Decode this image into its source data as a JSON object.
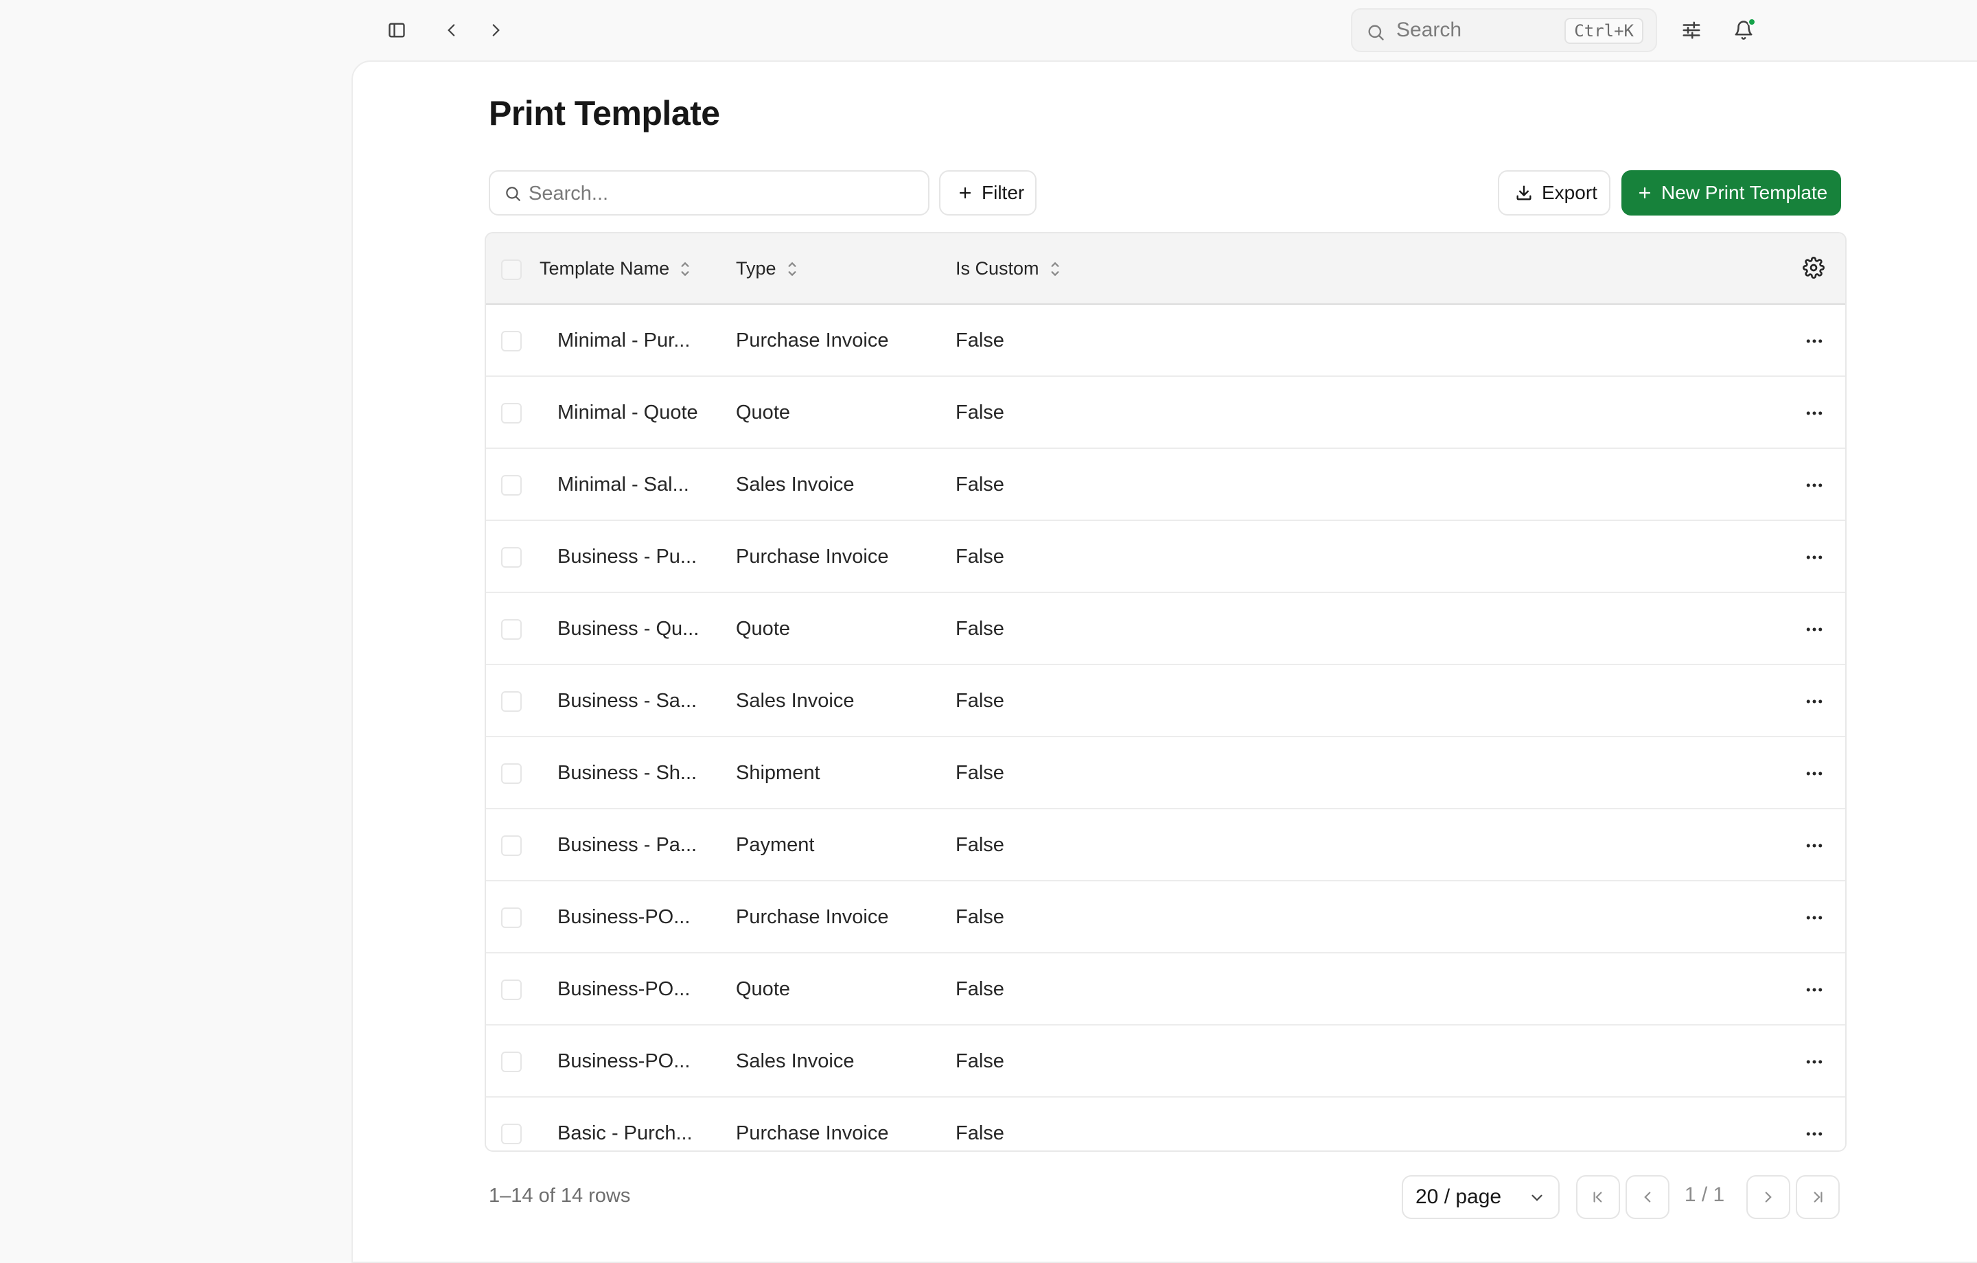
{
  "topbar": {
    "search_placeholder": "Search",
    "search_shortcut": "Ctrl+K"
  },
  "page": {
    "title": "Print Template"
  },
  "toolbar": {
    "search_placeholder": "Search...",
    "filter_label": "Filter",
    "export_label": "Export",
    "new_label": "New Print Template"
  },
  "table": {
    "columns": [
      "Template Name",
      "Type",
      "Is Custom"
    ],
    "rows": [
      {
        "name": "Minimal - Pur...",
        "type": "Purchase Invoice",
        "custom": "False"
      },
      {
        "name": "Minimal - Quote",
        "type": "Quote",
        "custom": "False"
      },
      {
        "name": "Minimal - Sal...",
        "type": "Sales Invoice",
        "custom": "False"
      },
      {
        "name": "Business - Pu...",
        "type": "Purchase Invoice",
        "custom": "False"
      },
      {
        "name": "Business - Qu...",
        "type": "Quote",
        "custom": "False"
      },
      {
        "name": "Business - Sa...",
        "type": "Sales Invoice",
        "custom": "False"
      },
      {
        "name": "Business - Sh...",
        "type": "Shipment",
        "custom": "False"
      },
      {
        "name": "Business - Pa...",
        "type": "Payment",
        "custom": "False"
      },
      {
        "name": "Business-PO...",
        "type": "Purchase Invoice",
        "custom": "False"
      },
      {
        "name": "Business-PO...",
        "type": "Quote",
        "custom": "False"
      },
      {
        "name": "Business-PO...",
        "type": "Sales Invoice",
        "custom": "False"
      },
      {
        "name": "Basic - Purch...",
        "type": "Purchase Invoice",
        "custom": "False"
      }
    ]
  },
  "footer": {
    "row_count": "1–14 of 14 rows",
    "page_size": "20 / page",
    "page_indicator": "1 / 1"
  },
  "colors": {
    "primary": "#17823b",
    "notification_dot": "#16a34a"
  },
  "icons": {
    "sidebar_toggle": "sidebar-toggle-icon",
    "back": "chevron-left-icon",
    "forward": "chevron-right-icon",
    "search": "search-icon",
    "customize": "sliders-icon",
    "notifications": "bell-icon",
    "filter": "plus-icon",
    "export": "download-icon",
    "new": "plus-icon",
    "sort": "sort-arrows-icon",
    "settings": "gear-icon",
    "row_actions": "more-horizontal-icon"
  }
}
